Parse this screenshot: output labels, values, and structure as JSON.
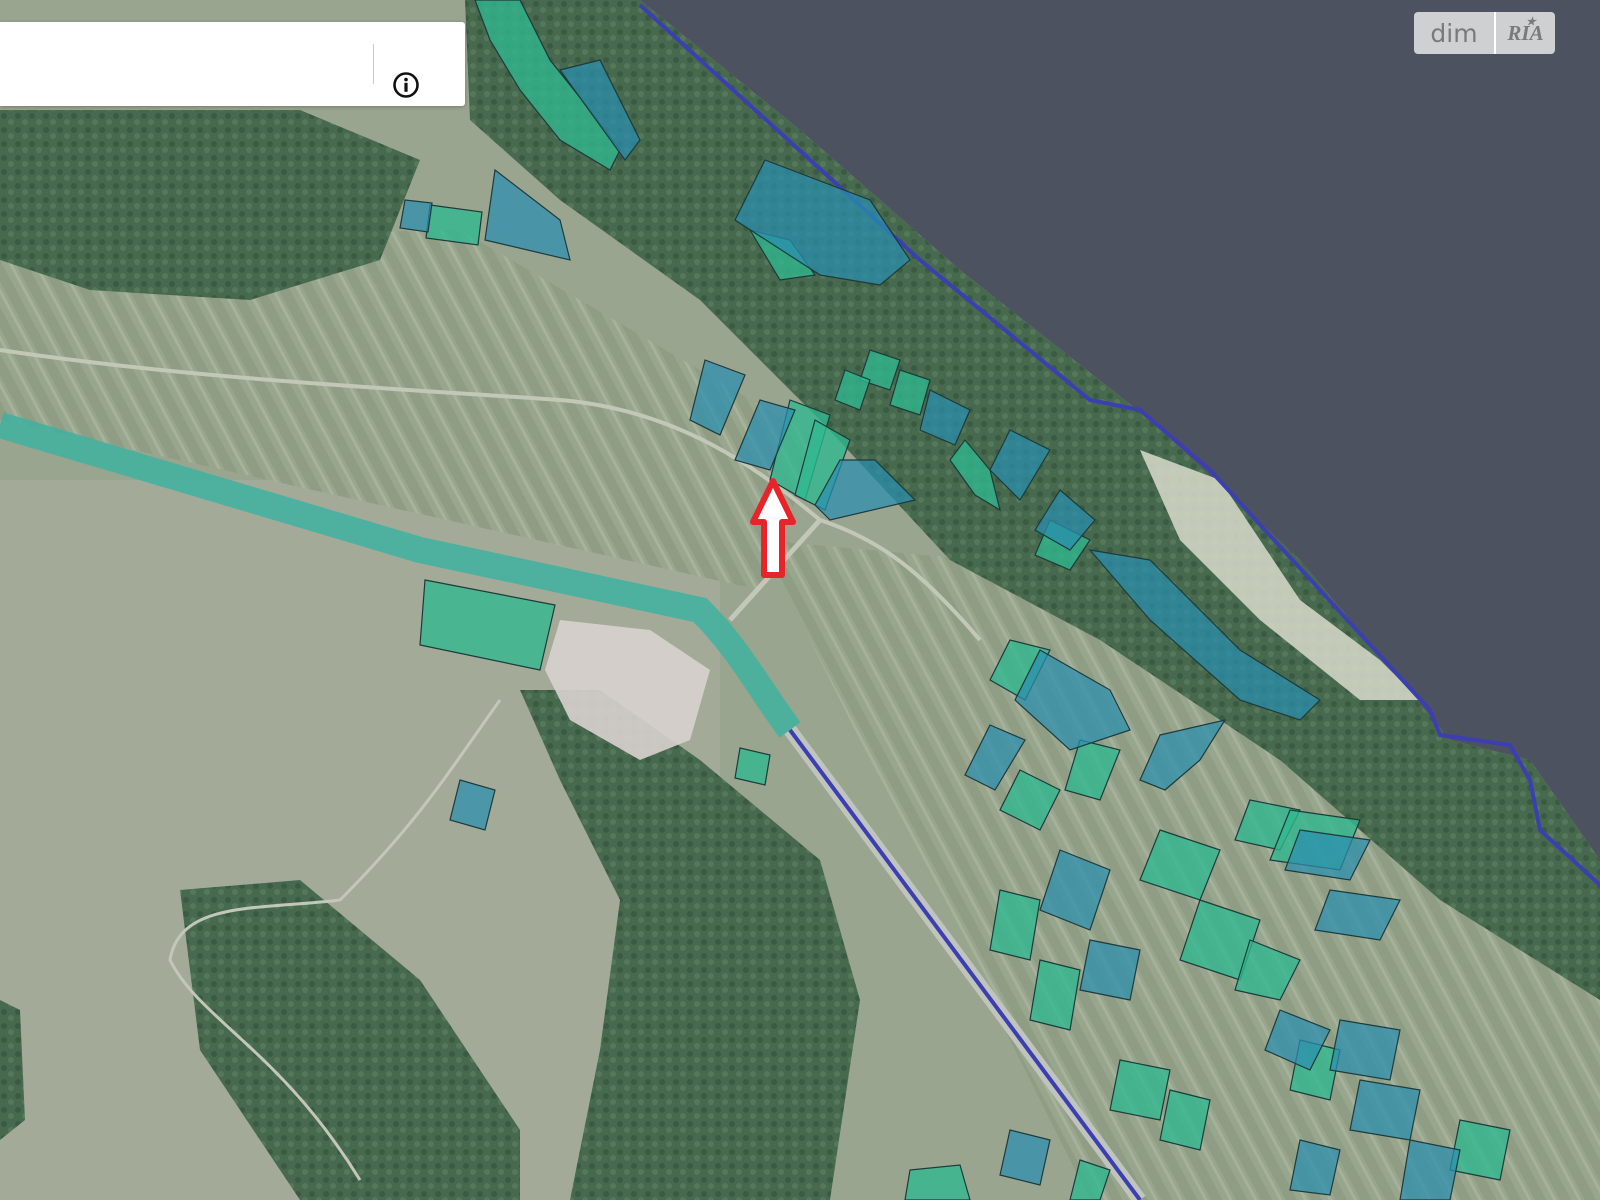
{
  "search": {
    "value": "",
    "placeholder": ""
  },
  "info_button": {
    "icon": "info-icon"
  },
  "watermark": {
    "left_text": "dim",
    "right_text": "RIA",
    "star": "★"
  },
  "marker": {
    "icon": "red-arrow-up-icon",
    "color": "#e8242b"
  },
  "colors": {
    "water": "#4c5260",
    "boundary": "#3b3fb0",
    "parcel_green": "#2fb98f",
    "parcel_blue": "#2a8fb0",
    "forest": "#42614a",
    "field": "#9aa78f",
    "canal": "#3fb2a0"
  }
}
